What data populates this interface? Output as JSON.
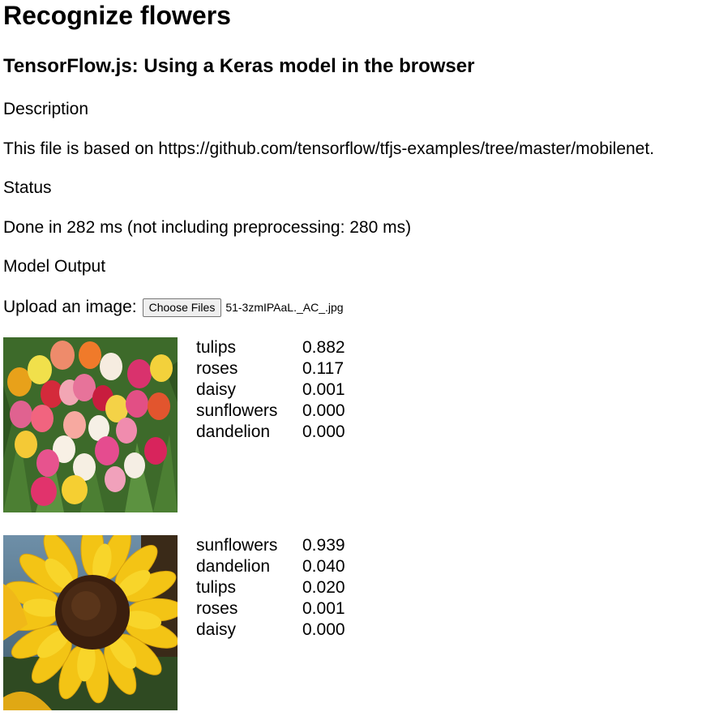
{
  "page": {
    "title": "Recognize flowers",
    "subtitle": "TensorFlow.js: Using a Keras model in the browser",
    "description_heading": "Description",
    "description_text": "This file is based on https://github.com/tensorflow/tfjs-examples/tree/master/mobilenet.",
    "status_heading": "Status",
    "status_text": "Done in 282 ms (not including preprocessing: 280 ms)",
    "output_heading": "Model Output"
  },
  "upload": {
    "label": "Upload an image:",
    "button_label": "Choose Files",
    "file_name": "51-3zmIPAaL._AC_.jpg"
  },
  "results": [
    {
      "image": "tulips-photo",
      "predictions": [
        {
          "class": "tulips",
          "prob": "0.882"
        },
        {
          "class": "roses",
          "prob": "0.117"
        },
        {
          "class": "daisy",
          "prob": "0.001"
        },
        {
          "class": "sunflowers",
          "prob": "0.000"
        },
        {
          "class": "dandelion",
          "prob": "0.000"
        }
      ]
    },
    {
      "image": "sunflower-photo",
      "predictions": [
        {
          "class": "sunflowers",
          "prob": "0.939"
        },
        {
          "class": "dandelion",
          "prob": "0.040"
        },
        {
          "class": "tulips",
          "prob": "0.020"
        },
        {
          "class": "roses",
          "prob": "0.001"
        },
        {
          "class": "daisy",
          "prob": "0.000"
        }
      ]
    }
  ]
}
